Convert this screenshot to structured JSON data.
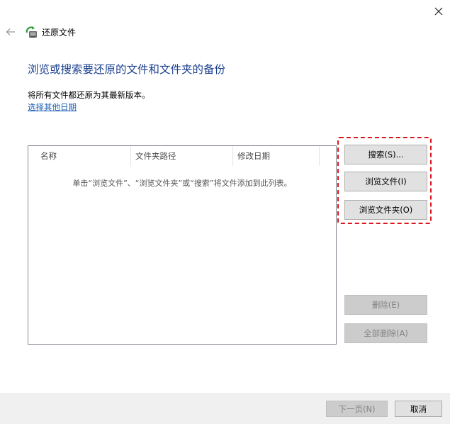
{
  "window": {
    "title": "还原文件",
    "close_glyph": "✕",
    "back_glyph": "←"
  },
  "main": {
    "heading": "浏览或搜索要还原的文件和文件夹的备份",
    "info_text": "将所有文件都还原为其最新版本。",
    "choose_date_link": "选择其他日期"
  },
  "list": {
    "columns": [
      "名称",
      "文件夹路径",
      "修改日期"
    ],
    "empty_message": "单击“浏览文件”、“浏览文件夹”或“搜索”将文件添加到此列表。"
  },
  "side_buttons": {
    "search": "搜索(S)...",
    "browse_files": "浏览文件(I)",
    "browse_folders": "浏览文件夹(O)",
    "delete": "删除(E)",
    "delete_all": "全部删除(A)"
  },
  "footer": {
    "next": "下一页(N)",
    "cancel": "取消"
  },
  "colors": {
    "heading": "#1a3f8f",
    "link": "#1a5fb4",
    "highlight": "#d9171c"
  },
  "icons": {
    "app": "backup-restore-icon",
    "back": "back-arrow-icon",
    "close": "close-icon"
  }
}
